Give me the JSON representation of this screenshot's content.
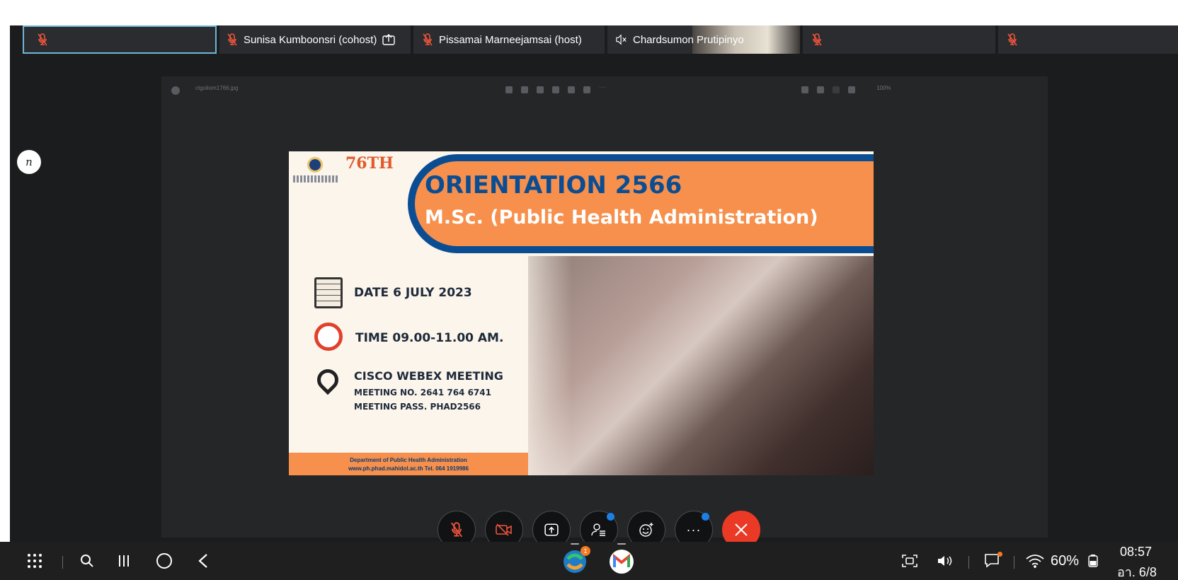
{
  "participants": [
    {
      "name": "",
      "muted": true
    },
    {
      "name": "Sunisa Kumboonsri (cohost)",
      "muted": true,
      "sharing": true
    },
    {
      "name": "Pissamai Marneejamsai (host)",
      "muted": true
    },
    {
      "name": "Chardsumon Prutipinyo",
      "speaker_muted": true
    },
    {
      "name": "",
      "muted": true
    },
    {
      "name": "",
      "muted": true
    }
  ],
  "annotation_badge": "n",
  "viewer": {
    "file_name": "ctgoilom1766.jpg",
    "zoom": "100%"
  },
  "poster": {
    "anniversary": "76TH",
    "title": "ORIENTATION 2566",
    "subtitle": "M.Sc. (Public Health Administration)",
    "date": "DATE  6 JULY 2023",
    "time": "TIME 09.00-11.00 AM.",
    "meeting": "CISCO WEBEX MEETING",
    "meeting_no": "MEETING NO. 2641 764 6741",
    "meeting_pass": "MEETING PASS. PHAD2566",
    "footer_line1": "Department of Public Health Administration",
    "footer_line2": "www.ph.phad.mahidol.ac.th   Tel. 064 1919986"
  },
  "controls": [
    "mute",
    "stop-video",
    "share",
    "participants",
    "reactions",
    "more",
    "end"
  ],
  "taskbar": {
    "battery": "60%",
    "time": "08:57",
    "date": "อา. 6/8",
    "notification_badge": "1"
  },
  "colors": {
    "accent": "#1b7fe6",
    "end_call": "#ea3a26",
    "muted_red": "#f0543b",
    "poster_orange": "#f6904c",
    "poster_blue": "#0b4d93"
  }
}
